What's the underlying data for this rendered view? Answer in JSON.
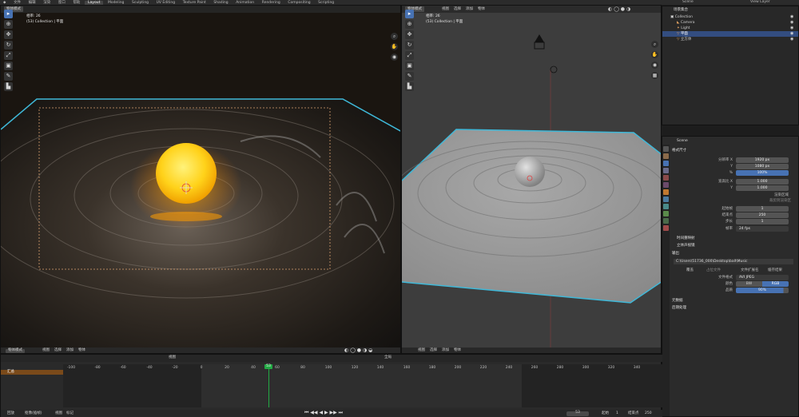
{
  "menu": {
    "items": [
      "文件",
      "编辑",
      "渲染",
      "窗口",
      "帮助"
    ],
    "workspaces": [
      "Layout",
      "Modeling",
      "Sculpting",
      "UV Editing",
      "Texture Paint",
      "Shading",
      "Animation",
      "Rendering",
      "Compositing",
      "Scripting"
    ],
    "active_workspace": "Layout",
    "scene_label": "Scene",
    "view_layer_label": "View Layer"
  },
  "left_viewport": {
    "mode": "物体模式",
    "menus": [
      "视图",
      "选择",
      "添加",
      "物体"
    ],
    "info_line1": "相率: 26",
    "info_line2": "(53) Collection | 平面",
    "bottom_mode": "物体模式",
    "bottom_menus": [
      "视图",
      "选择",
      "添加",
      "物体"
    ]
  },
  "right_viewport": {
    "mode": "物体模式",
    "menus": [
      "视图",
      "选择",
      "添加",
      "物体"
    ],
    "info_line1": "相率: 26",
    "info_line2": "(53) Collection | 平面",
    "bottom_menus": [
      "视图",
      "选择",
      "添加",
      "物体"
    ],
    "transform": "全局"
  },
  "outliner": {
    "title": "场景集合",
    "rows": [
      {
        "label": "Collection",
        "indent": 0,
        "selected": false
      },
      {
        "label": "Camera",
        "indent": 1,
        "selected": false
      },
      {
        "label": "Light",
        "indent": 1,
        "selected": false
      },
      {
        "label": "平面",
        "indent": 1,
        "selected": true
      },
      {
        "label": "立方体",
        "indent": 1,
        "selected": false
      }
    ]
  },
  "properties": {
    "scene_name": "Scene",
    "sections": {
      "format": "格式尺寸",
      "time_stretch": "时间重映射",
      "stereo": "立体声视镜",
      "output": "输出",
      "metadata": "元数据",
      "post": "后期处理"
    },
    "fields": [
      {
        "label": "分辨率 X",
        "value": "1920 px"
      },
      {
        "label": "Y",
        "value": "1080 px"
      },
      {
        "label": "%",
        "value": "100%"
      },
      {
        "label": "宽高比 X",
        "value": "1.000"
      },
      {
        "label": "Y",
        "value": "1.000"
      }
    ],
    "checkbox1": "渲染区域",
    "checkbox2": "裁剪到渲染区",
    "frames": [
      {
        "label": "起始帧",
        "value": "1"
      },
      {
        "label": "结束点",
        "value": "250"
      },
      {
        "label": "步长",
        "value": "1"
      },
      {
        "label": "帧率",
        "value": "24 fps"
      }
    ],
    "output_path": "C:\\Users\\51736_000\\Desktop\\ball\\Music",
    "saving_label": "覆盖",
    "placeholder_label": "占位文件",
    "ext_label": "文件扩展名",
    "cache_label": "缓存结果",
    "file_format_label": "文件格式",
    "file_format": "AVI JPEG",
    "color_label": "颜色",
    "color_bw": "BW",
    "color_rgb": "RGB",
    "quality_label": "品质",
    "quality": "90%"
  },
  "timeline": {
    "playback": "回放",
    "keying": "抠像(插帧)",
    "view": "视图",
    "marker": "标记",
    "summary": "汇总",
    "current_frame": "53",
    "start_label": "起始",
    "start": "1",
    "end_label": "结束点",
    "end": "250",
    "ticks": [
      "-100",
      "-80",
      "-60",
      "-40",
      "-20",
      "0",
      "20",
      "40",
      "60",
      "80",
      "100",
      "120",
      "140",
      "160",
      "180",
      "200",
      "220",
      "240",
      "260",
      "280",
      "300",
      "320",
      "340"
    ],
    "playhead_label": "53"
  },
  "colors": {
    "accent_blue": "#4772b3",
    "selection": "#334d80",
    "playhead": "#22aa44",
    "sun": "#ffd21a",
    "plane_outline": "#3fb8d8"
  }
}
